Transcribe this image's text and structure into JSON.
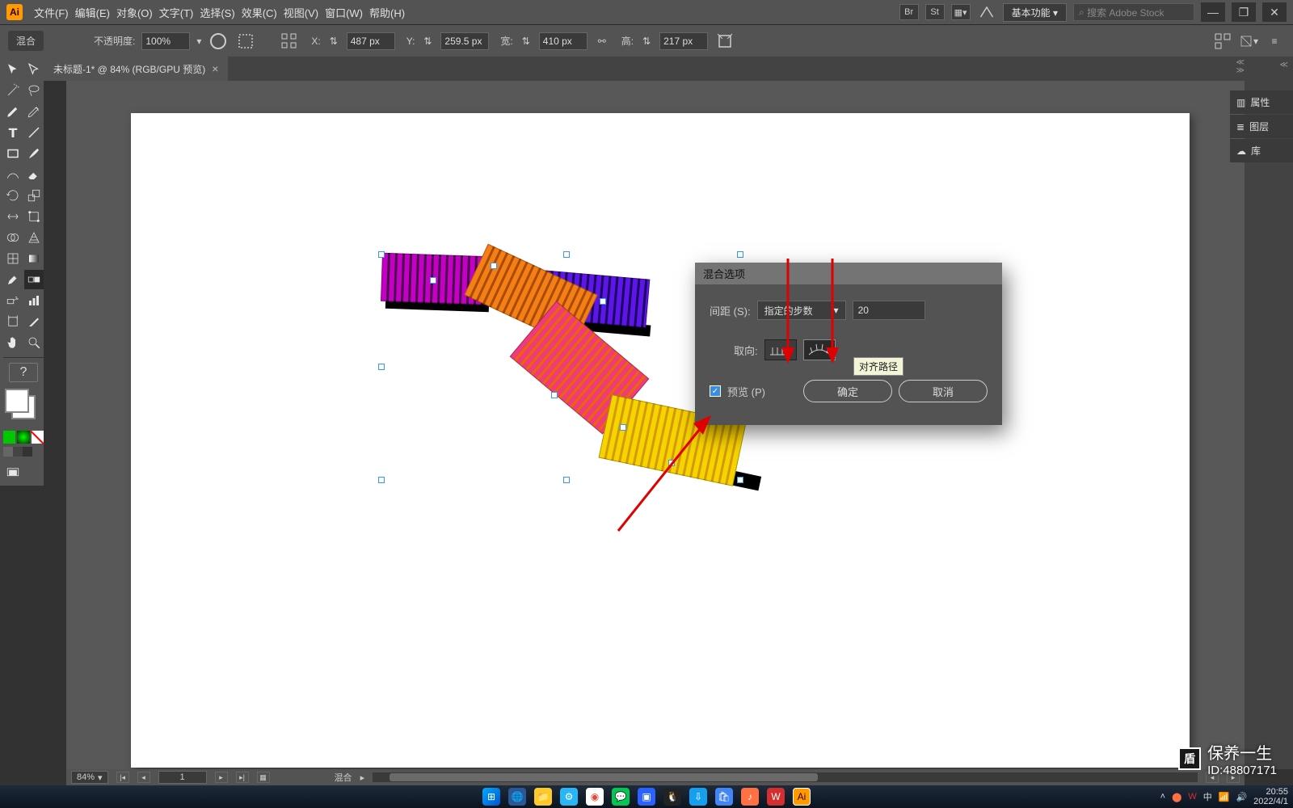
{
  "menubar": {
    "items": [
      "文件(F)",
      "编辑(E)",
      "对象(O)",
      "文字(T)",
      "选择(S)",
      "效果(C)",
      "视图(V)",
      "窗口(W)",
      "帮助(H)"
    ],
    "workspace": "基本功能",
    "search_placeholder": "搜索 Adobe Stock"
  },
  "optbar": {
    "tag": "混合",
    "opacity_label": "不透明度:",
    "opacity_value": "100%",
    "x_label": "X:",
    "x_value": "487 px",
    "y_label": "Y:",
    "y_value": "259.5 px",
    "w_label": "宽:",
    "w_value": "410 px",
    "h_label": "高:",
    "h_value": "217 px"
  },
  "doc_tab": {
    "title": "未标题-1* @ 84% (RGB/GPU 预览)"
  },
  "right_panels": {
    "items": [
      "属性",
      "图层",
      "库"
    ]
  },
  "dialog": {
    "title": "混合选项",
    "spacing_label": "间距 (S):",
    "spacing_mode": "指定的步数",
    "spacing_value": "20",
    "orient_label": "取向:",
    "tooltip": "对齐路径",
    "preview_label": "预览 (P)",
    "ok": "确定",
    "cancel": "取消"
  },
  "status": {
    "zoom": "84%",
    "artboard_nav": "1",
    "tool_label": "混合"
  },
  "tray": {
    "time": "20:55",
    "date": "2022/4/1"
  },
  "watermark": {
    "brand": "保养一生",
    "id": "ID:48807171"
  }
}
